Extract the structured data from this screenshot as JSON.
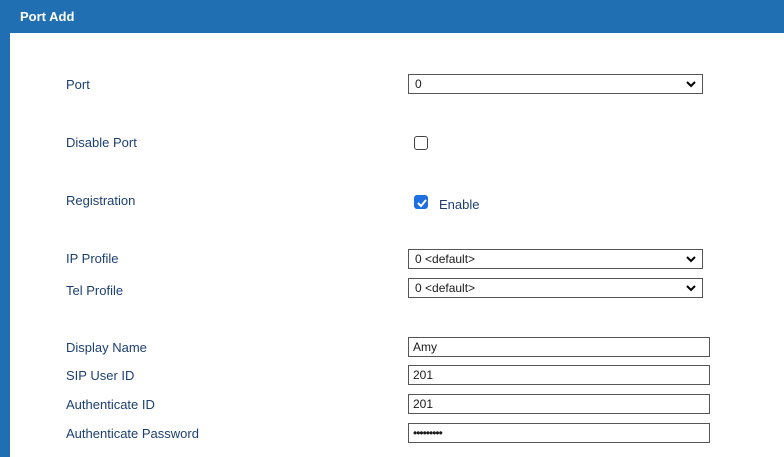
{
  "title": "Port Add",
  "fields": {
    "port": {
      "label": "Port",
      "value": "0"
    },
    "disable_port": {
      "label": "Disable Port",
      "checked": false
    },
    "registration": {
      "label": "Registration",
      "checkbox_label": "Enable",
      "checked": true
    },
    "ip_profile": {
      "label": "IP Profile",
      "value": "0 <default>"
    },
    "tel_profile": {
      "label": "Tel Profile",
      "value": "0 <default>"
    },
    "display_name": {
      "label": "Display Name",
      "value": "Amy"
    },
    "sip_user_id": {
      "label": "SIP User ID",
      "value": "201"
    },
    "authenticate_id": {
      "label": "Authenticate ID",
      "value": "201"
    },
    "authenticate_password": {
      "label": "Authenticate Password",
      "value": "•••••••••"
    }
  },
  "colors": {
    "accent": "#1f6fb2",
    "label": "#1c3f73",
    "checkbox": "#1f6fe0"
  },
  "icons": {
    "dropdown": "chevron-down-icon",
    "check": "check-icon"
  }
}
